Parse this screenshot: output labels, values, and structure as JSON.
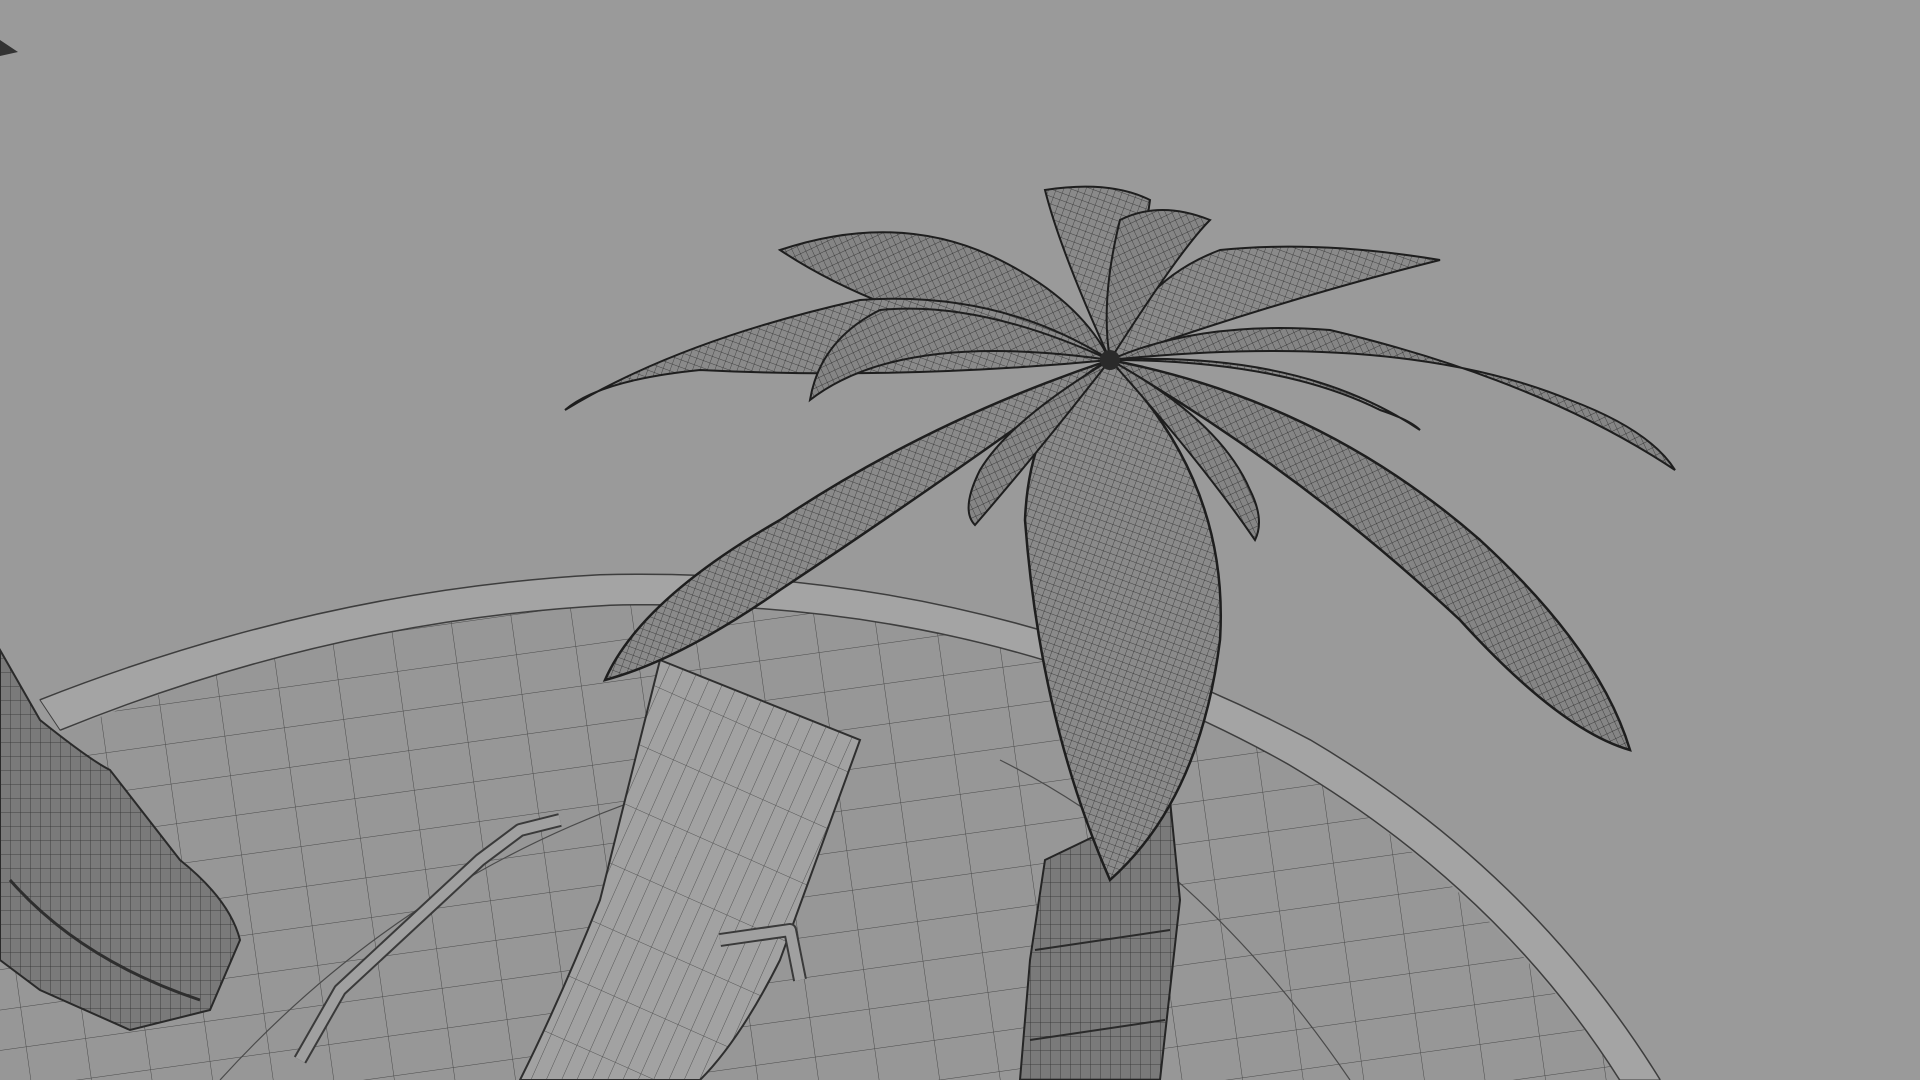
{
  "viewport": {
    "background_color": "#9a9a9a",
    "render_mode": "wireframe-on-shaded",
    "wire_color": "#2a2a2a",
    "surface_color": "#8d8d8d",
    "foliage_color": "#7e7e7e"
  },
  "scene": {
    "objects": [
      "palm-tree",
      "palm-trunk-left",
      "sun-lounger",
      "circular-deck"
    ]
  }
}
